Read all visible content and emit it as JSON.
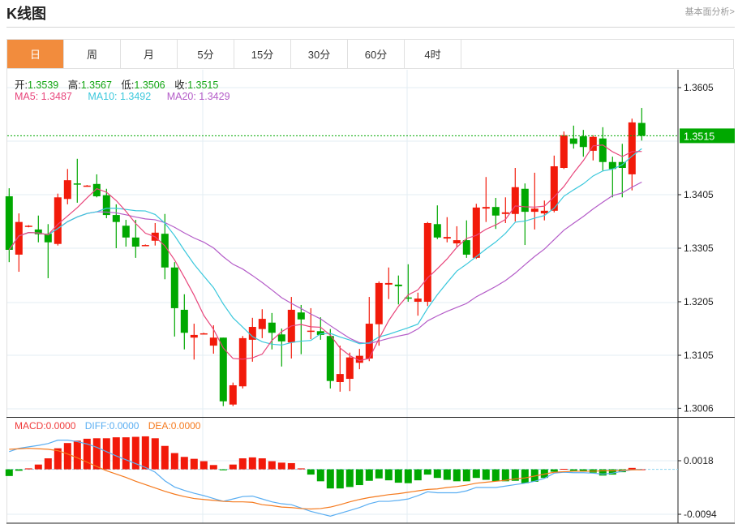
{
  "header": {
    "title": "K线图",
    "link": "基本面分析>"
  },
  "tabs": [
    {
      "label": "日",
      "active": true
    },
    {
      "label": "周"
    },
    {
      "label": "月"
    },
    {
      "label": "5分"
    },
    {
      "label": "15分"
    },
    {
      "label": "30分"
    },
    {
      "label": "60分"
    },
    {
      "label": "4时"
    }
  ],
  "ohlc_info": {
    "open_label": "开:",
    "open": "1.3539",
    "high_label": "高:",
    "high": "1.3567",
    "low_label": "低:",
    "low": "1.3506",
    "close_label": "收:",
    "close": "1.3515"
  },
  "ma_info": {
    "ma5": "MA5: 1.3487",
    "ma10": "MA10: 1.3492",
    "ma20": "MA20: 1.3429"
  },
  "macd_info": {
    "macd": "MACD:0.0000",
    "diff": "DIFF:0.0000",
    "dea": "DEA:0.0000"
  },
  "colors": {
    "up": "#f21a0a",
    "down": "#00a800",
    "ma5": "#e8467c",
    "ma10": "#3bc8dc",
    "ma20": "#b45cc8",
    "diff": "#5aaef2",
    "dea": "#f57a1e",
    "accent": "#f28c3d"
  },
  "chart_data": [
    {
      "type": "candlestick",
      "yticks": [
        "1.3605",
        "1.3405",
        "1.3305",
        "1.3205",
        "1.3105",
        "1.3006"
      ],
      "ytick_values": [
        1.3605,
        1.3405,
        1.3305,
        1.3205,
        1.3105,
        1.3006
      ],
      "ylim": [
        1.3006,
        1.3605
      ],
      "current_price": "1.3515",
      "grid": true,
      "ohlc": [
        [
          1.3402,
          1.3417,
          1.3279,
          1.3302
        ],
        [
          1.3293,
          1.337,
          1.3261,
          1.3354
        ],
        [
          1.3346,
          1.3348,
          1.3344,
          1.3347
        ],
        [
          1.334,
          1.3366,
          1.3316,
          1.3331
        ],
        [
          1.3332,
          1.335,
          1.3249,
          1.3316
        ],
        [
          1.3313,
          1.3407,
          1.331,
          1.34
        ],
        [
          1.3397,
          1.3453,
          1.3387,
          1.3432
        ],
        [
          1.3426,
          1.3472,
          1.339,
          1.3425
        ],
        [
          1.3421,
          1.3423,
          1.342,
          1.3422
        ],
        [
          1.3425,
          1.3443,
          1.34,
          1.3402
        ],
        [
          1.3404,
          1.3416,
          1.3361,
          1.3367
        ],
        [
          1.3367,
          1.3387,
          1.3305,
          1.3354
        ],
        [
          1.3347,
          1.3358,
          1.3308,
          1.3325
        ],
        [
          1.3325,
          1.3358,
          1.3287,
          1.3308
        ],
        [
          1.331,
          1.3312,
          1.3309,
          1.3311
        ],
        [
          1.3319,
          1.3352,
          1.331,
          1.3334
        ],
        [
          1.3332,
          1.3369,
          1.3247,
          1.3269
        ],
        [
          1.3269,
          1.3279,
          1.314,
          1.3193
        ],
        [
          1.319,
          1.3219,
          1.3116,
          1.3147
        ],
        [
          1.3138,
          1.3164,
          1.3097,
          1.3143
        ],
        [
          1.3145,
          1.3147,
          1.3144,
          1.3146
        ],
        [
          1.3123,
          1.3161,
          1.3108,
          1.3138
        ],
        [
          1.3138,
          1.3138,
          1.301,
          1.3019
        ],
        [
          1.3013,
          1.3054,
          1.301,
          1.3049
        ],
        [
          1.3047,
          1.3141,
          1.3043,
          1.3137
        ],
        [
          1.3134,
          1.3175,
          1.3093,
          1.3158
        ],
        [
          1.3154,
          1.3191,
          1.3137,
          1.3173
        ],
        [
          1.3166,
          1.3184,
          1.3116,
          1.3147
        ],
        [
          1.3144,
          1.3155,
          1.3084,
          1.3131
        ],
        [
          1.3129,
          1.3214,
          1.3099,
          1.319
        ],
        [
          1.3185,
          1.3199,
          1.3107,
          1.3172
        ],
        [
          1.3149,
          1.3193,
          1.3135,
          1.3151
        ],
        [
          1.315,
          1.3176,
          1.3134,
          1.3143
        ],
        [
          1.3141,
          1.3154,
          1.3043,
          1.3057
        ],
        [
          1.3055,
          1.3123,
          1.3037,
          1.307
        ],
        [
          1.3061,
          1.311,
          1.3038,
          1.3101
        ],
        [
          1.3091,
          1.3117,
          1.3079,
          1.3104
        ],
        [
          1.3099,
          1.3214,
          1.3094,
          1.3164
        ],
        [
          1.3163,
          1.3243,
          1.3123,
          1.324
        ],
        [
          1.3237,
          1.3269,
          1.321,
          1.324
        ],
        [
          1.3237,
          1.3254,
          1.32,
          1.3234
        ],
        [
          1.3213,
          1.3275,
          1.3205,
          1.3211
        ],
        [
          1.3205,
          1.3222,
          1.3179,
          1.3211
        ],
        [
          1.3205,
          1.3354,
          1.3197,
          1.3352
        ],
        [
          1.335,
          1.3385,
          1.3322,
          1.3325
        ],
        [
          1.3323,
          1.3363,
          1.3316,
          1.3326
        ],
        [
          1.3314,
          1.3346,
          1.3307,
          1.332
        ],
        [
          1.332,
          1.3357,
          1.3287,
          1.3293
        ],
        [
          1.3287,
          1.3388,
          1.3285,
          1.3381
        ],
        [
          1.3379,
          1.3438,
          1.3354,
          1.3382
        ],
        [
          1.3382,
          1.3399,
          1.3341,
          1.3366
        ],
        [
          1.3369,
          1.34,
          1.3352,
          1.3372
        ],
        [
          1.3369,
          1.3455,
          1.3355,
          1.3419
        ],
        [
          1.3416,
          1.3426,
          1.3311,
          1.3373
        ],
        [
          1.3373,
          1.3446,
          1.334,
          1.3379
        ],
        [
          1.337,
          1.3394,
          1.3357,
          1.3375
        ],
        [
          1.3375,
          1.3478,
          1.3372,
          1.3458
        ],
        [
          1.3455,
          1.3523,
          1.3453,
          1.3516
        ],
        [
          1.351,
          1.3534,
          1.3491,
          1.35
        ],
        [
          1.3514,
          1.3526,
          1.3476,
          1.3494
        ],
        [
          1.3487,
          1.3516,
          1.3469,
          1.3513
        ],
        [
          1.351,
          1.3531,
          1.345,
          1.3466
        ],
        [
          1.3466,
          1.3476,
          1.34,
          1.3453
        ],
        [
          1.3466,
          1.35,
          1.34,
          1.3455
        ],
        [
          1.3443,
          1.3547,
          1.3413,
          1.354
        ],
        [
          1.3539,
          1.3567,
          1.3506,
          1.3515
        ]
      ]
    },
    {
      "type": "bar+line",
      "yticks": [
        "0.0018",
        "-0.0094"
      ],
      "ytick_values": [
        0.0018,
        -0.0094
      ],
      "macd": [
        -0.0014,
        -0.0003,
        0.0002,
        0.001,
        0.0023,
        0.0044,
        0.0055,
        0.006,
        0.0064,
        0.0065,
        0.0065,
        0.0067,
        0.0067,
        0.0068,
        0.0069,
        0.0065,
        0.0049,
        0.0034,
        0.0026,
        0.0022,
        0.0017,
        0.0009,
        -0.0002,
        0.001,
        0.0023,
        0.0025,
        0.0023,
        0.0017,
        0.0014,
        0.0013,
        0.0002,
        -0.0011,
        -0.0025,
        -0.004,
        -0.004,
        -0.0037,
        -0.0033,
        -0.0024,
        -0.0019,
        -0.0023,
        -0.0028,
        -0.0029,
        -0.0023,
        -0.0011,
        -0.0018,
        -0.0022,
        -0.0025,
        -0.0025,
        -0.0018,
        -0.0022,
        -0.0025,
        -0.0025,
        -0.0024,
        -0.0029,
        -0.0026,
        -0.0018,
        -0.0005,
        0.0001,
        -0.0003,
        -0.0005,
        -0.0007,
        -0.0013,
        -0.0011,
        -0.0006,
        0.0003,
        0.0
      ],
      "diff": [
        0.0037,
        0.0044,
        0.0047,
        0.005,
        0.0054,
        0.0061,
        0.0061,
        0.0058,
        0.0053,
        0.0046,
        0.0037,
        0.0028,
        0.002,
        0.0012,
        0.0004,
        -0.0006,
        -0.0024,
        -0.0037,
        -0.0044,
        -0.005,
        -0.0055,
        -0.0061,
        -0.0067,
        -0.0062,
        -0.0057,
        -0.0056,
        -0.0062,
        -0.0068,
        -0.0072,
        -0.0074,
        -0.0081,
        -0.0088,
        -0.0093,
        -0.0098,
        -0.0092,
        -0.0086,
        -0.008,
        -0.0072,
        -0.0067,
        -0.0067,
        -0.0065,
        -0.0062,
        -0.0055,
        -0.0047,
        -0.0049,
        -0.0049,
        -0.0049,
        -0.0045,
        -0.0038,
        -0.0038,
        -0.0038,
        -0.0035,
        -0.0032,
        -0.0029,
        -0.0025,
        -0.0019,
        -0.0008,
        -0.0006,
        -0.0007,
        -0.0007,
        -0.0008,
        -0.001,
        -0.0008,
        -0.0004,
        -0.0001,
        0.0
      ],
      "dea": [
        0.0042,
        0.0043,
        0.0044,
        0.0043,
        0.0042,
        0.0039,
        0.0032,
        0.0024,
        0.0015,
        0.0006,
        -0.0003,
        -0.001,
        -0.0017,
        -0.0025,
        -0.0032,
        -0.0039,
        -0.0046,
        -0.0052,
        -0.0057,
        -0.0061,
        -0.0063,
        -0.0065,
        -0.0067,
        -0.0068,
        -0.0068,
        -0.0069,
        -0.0074,
        -0.0076,
        -0.0079,
        -0.008,
        -0.0082,
        -0.0083,
        -0.0082,
        -0.0079,
        -0.0074,
        -0.0068,
        -0.0063,
        -0.0059,
        -0.0056,
        -0.0053,
        -0.0051,
        -0.0048,
        -0.0045,
        -0.0042,
        -0.0041,
        -0.0038,
        -0.0036,
        -0.0033,
        -0.0029,
        -0.0027,
        -0.0025,
        -0.0023,
        -0.002,
        -0.0018,
        -0.0014,
        -0.001,
        -0.0006,
        -0.0005,
        -0.0004,
        -0.0004,
        -0.0004,
        -0.0003,
        -0.0003,
        -0.0002,
        -0.0001,
        -0.0001
      ]
    }
  ]
}
